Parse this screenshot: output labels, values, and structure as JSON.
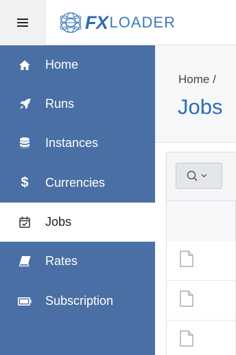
{
  "header": {
    "logo_fx": "FX",
    "logo_loader": "LOADER",
    "menu_icon": "hamburger-menu-icon"
  },
  "sidebar": {
    "items": [
      {
        "label": "Home",
        "icon": "home-icon",
        "active": false
      },
      {
        "label": "Runs",
        "icon": "rocket-icon",
        "active": false
      },
      {
        "label": "Instances",
        "icon": "database-icon",
        "active": false
      },
      {
        "label": "Currencies",
        "icon": "dollar-icon",
        "active": false
      },
      {
        "label": "Jobs",
        "icon": "calendar-check-icon",
        "active": true
      },
      {
        "label": "Rates",
        "icon": "book-icon",
        "active": false
      },
      {
        "label": "Subscription",
        "icon": "battery-icon",
        "active": false
      }
    ]
  },
  "main": {
    "breadcrumb": "Home /",
    "title": "Jobs",
    "toolbar": {
      "search_icon": "search-icon",
      "dropdown_icon": "chevron-down-icon"
    },
    "rows": [
      {
        "icon": "document-icon"
      },
      {
        "icon": "document-icon"
      },
      {
        "icon": "document-icon"
      }
    ]
  },
  "colors": {
    "sidebar_bg": "#4a6fa4",
    "accent": "#2f6bb5",
    "active_item_bg": "#ffffff"
  }
}
